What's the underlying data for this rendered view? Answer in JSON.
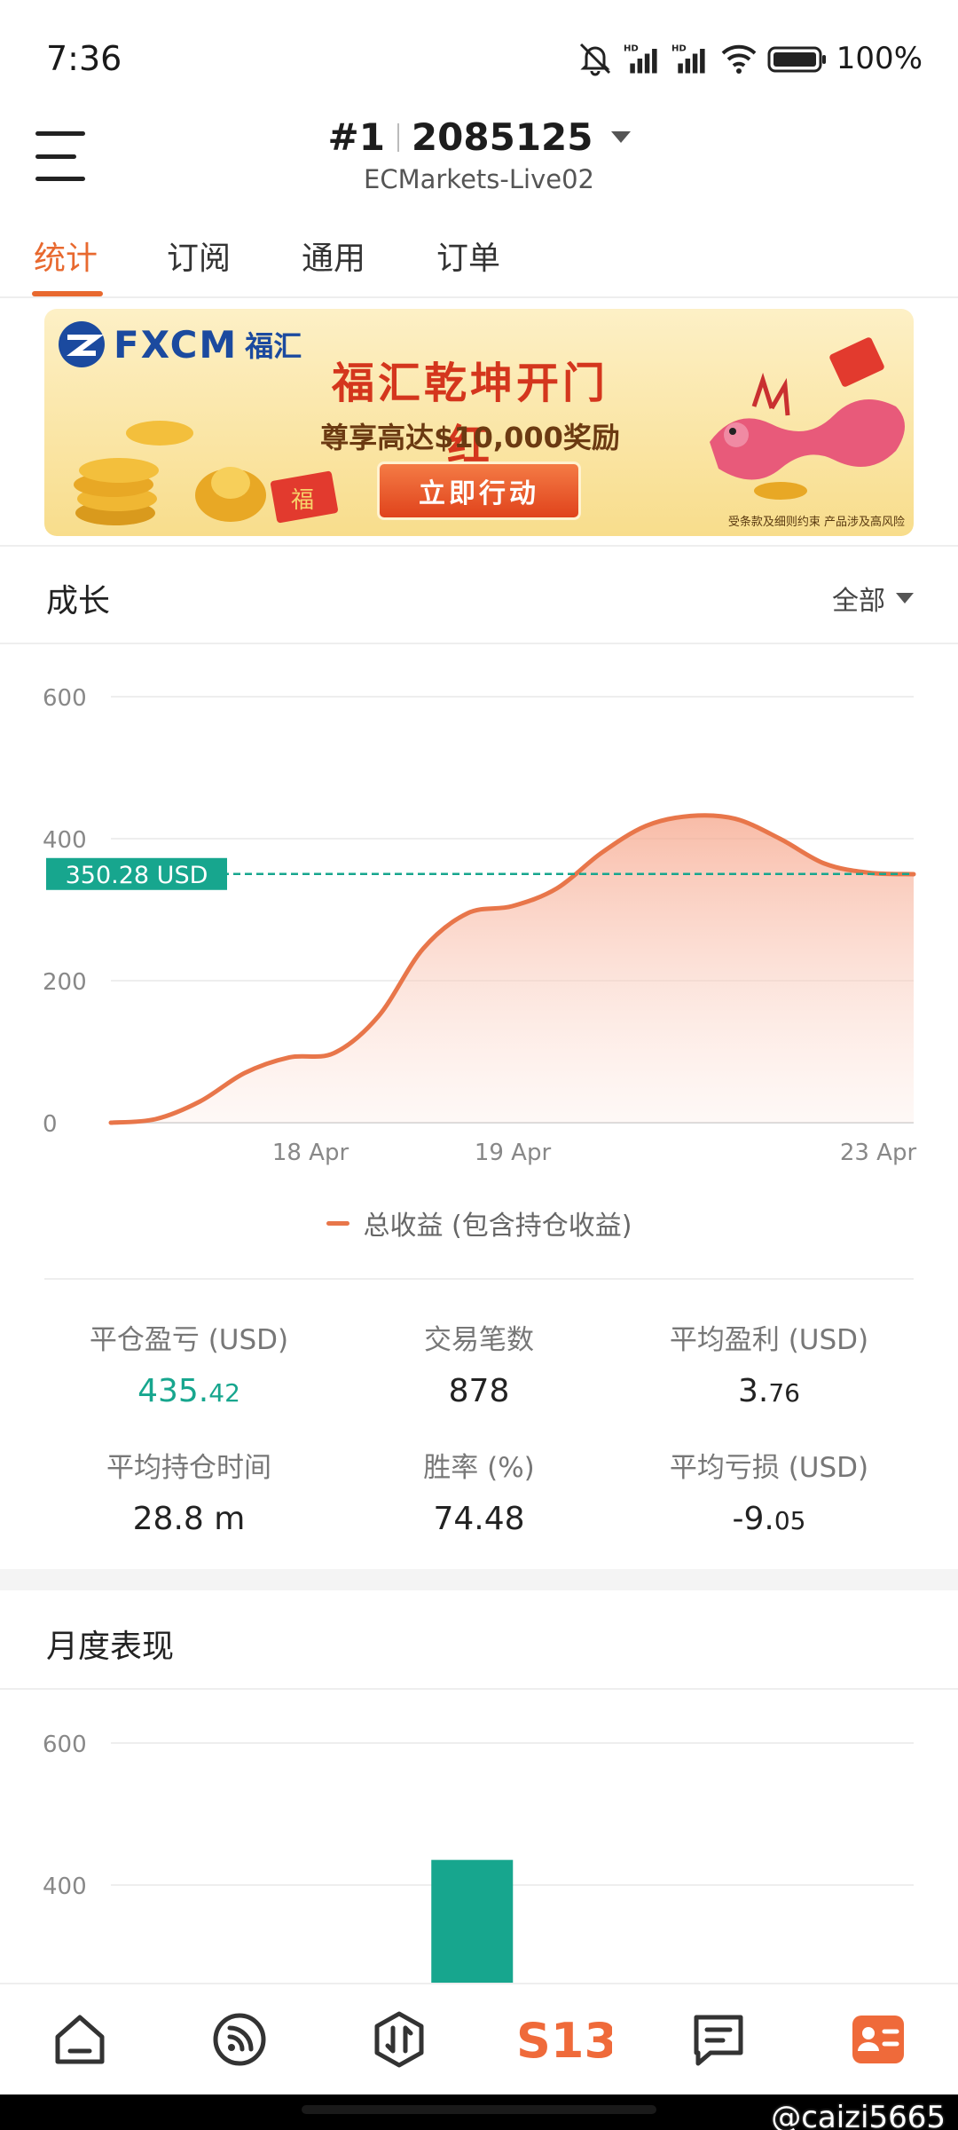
{
  "status_bar": {
    "time": "7:36",
    "battery": "100%",
    "hd1": "HD",
    "hd2": "HD"
  },
  "header": {
    "account_no": "#1",
    "account_id": "2085125",
    "server": "ECMarkets-Live02"
  },
  "tabs": [
    {
      "label": "统计",
      "active": true
    },
    {
      "label": "订阅",
      "active": false
    },
    {
      "label": "通用",
      "active": false
    },
    {
      "label": "订单",
      "active": false
    }
  ],
  "banner": {
    "brand_name": "FXCM",
    "brand_cn": "福汇",
    "title": "福汇乾坤开门红",
    "subtitle": "尊享高达$10,000奖励",
    "button": "立即行动",
    "note": "受条款及细则约束  产品涉及高风险",
    "stamp": "福"
  },
  "growth": {
    "title": "成长",
    "range": "全部",
    "legend": "总收益 (包含持仓收益)",
    "current_label": "350.28 USD"
  },
  "chart_data": [
    {
      "type": "area",
      "title": "",
      "y_ticks": [
        "600",
        "400",
        "200",
        "0"
      ],
      "x_ticks": [
        "18 Apr",
        "19 Apr",
        "23 Apr"
      ],
      "ylim": [
        0,
        600
      ],
      "series": [
        {
          "name": "总收益 (包含持仓收益)",
          "values": [
            0,
            5,
            30,
            70,
            92,
            98,
            150,
            245,
            295,
            305,
            330,
            380,
            418,
            432,
            428,
            400,
            365,
            352,
            350
          ]
        }
      ],
      "reference_line": 350.28,
      "color": "#e8764a",
      "ref_color": "#17a68e"
    },
    {
      "type": "bar",
      "title": "",
      "y_ticks": [
        "600",
        "400"
      ],
      "ylim": [
        0,
        600
      ],
      "bars": [
        {
          "index": 4,
          "of": 10,
          "value": 435.42
        }
      ],
      "color": "#17a68e"
    }
  ],
  "stats": [
    {
      "label": "平仓盈亏 (USD)",
      "value_int": "435.",
      "value_dec": "42",
      "positive": true
    },
    {
      "label": "交易笔数",
      "value_int": "878",
      "value_dec": "",
      "positive": false
    },
    {
      "label": "平均盈利 (USD)",
      "value_int": "3.",
      "value_dec": "76",
      "positive": false
    },
    {
      "label": "平均持仓时间",
      "value_int": "28.8 m",
      "value_dec": "",
      "positive": false
    },
    {
      "label": "胜率 (%)",
      "value_int": "74.48",
      "value_dec": "",
      "positive": false
    },
    {
      "label": "平均亏损 (USD)",
      "value_int": "-9.",
      "value_dec": "05",
      "positive": false
    }
  ],
  "monthly": {
    "title": "月度表现"
  },
  "bottom_nav": [
    {
      "name": "home-icon"
    },
    {
      "name": "signal-icon"
    },
    {
      "name": "trade-icon"
    },
    {
      "name": "s13-logo",
      "label": "S13"
    },
    {
      "name": "messages-icon"
    },
    {
      "name": "profile-icon"
    }
  ],
  "watermark": "@caizi5665",
  "colors": {
    "accent": "#e8692f",
    "positive": "#17a68e"
  }
}
